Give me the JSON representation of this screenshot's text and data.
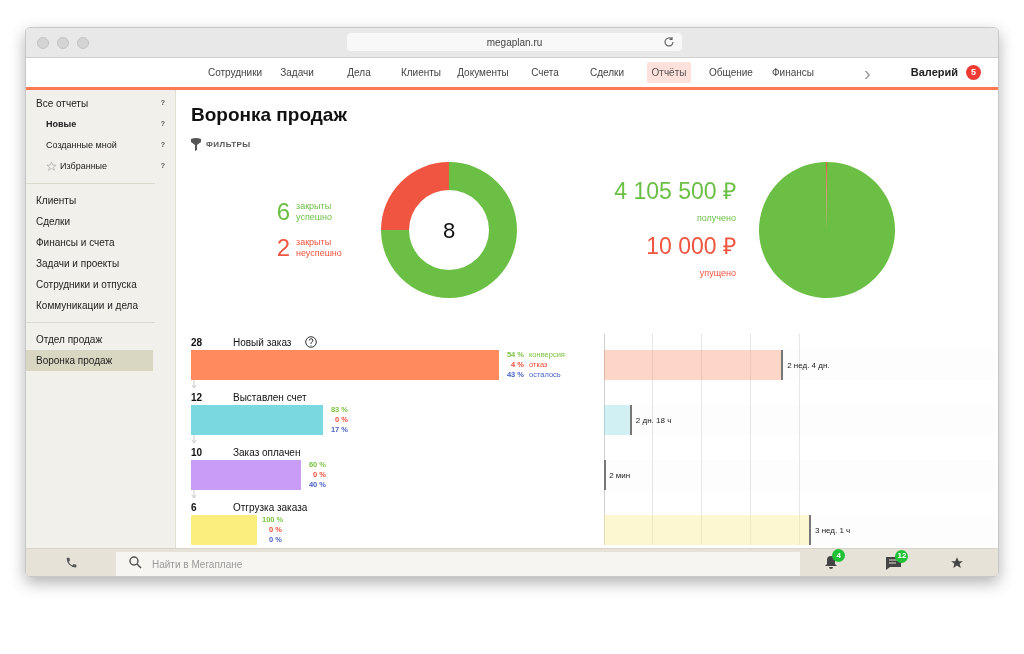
{
  "browser": {
    "url": "megaplan.ru"
  },
  "nav": {
    "items": [
      {
        "label": "Сотрудники",
        "selected": false
      },
      {
        "label": "Задачи",
        "selected": false
      },
      {
        "label": "Дела",
        "selected": false
      },
      {
        "label": "Клиенты",
        "selected": false
      },
      {
        "label": "Документы",
        "selected": false
      },
      {
        "label": "Счета",
        "selected": false
      },
      {
        "label": "Сделки",
        "selected": false
      },
      {
        "label": "Отчёты",
        "selected": true
      },
      {
        "label": "Общение",
        "selected": false
      },
      {
        "label": "Финансы",
        "selected": false
      }
    ],
    "more": "›",
    "user": "Валерий",
    "user_badge": "5"
  },
  "sidebar": {
    "groups": [
      {
        "items": [
          {
            "label": "Все отчеты",
            "help": "?",
            "selected": false,
            "children": [
              {
                "label": "Новые",
                "help": "?",
                "kind": "plain",
                "active": true
              },
              {
                "label": "Созданные мной",
                "help": "?",
                "kind": "plain",
                "active": false
              },
              {
                "label": "Избранные",
                "help": "?",
                "kind": "starred",
                "active": false
              }
            ]
          }
        ]
      },
      {
        "items": [
          {
            "label": "Клиенты",
            "selected": false
          },
          {
            "label": "Сделки",
            "selected": false
          },
          {
            "label": "Финансы и счета",
            "selected": false
          },
          {
            "label": "Задачи и проекты",
            "selected": false
          },
          {
            "label": "Сотрудники и отпуска",
            "selected": false
          },
          {
            "label": "Коммуникации и дела",
            "selected": false
          }
        ]
      },
      {
        "items": [
          {
            "label": "Отдел продаж",
            "selected": false
          },
          {
            "label": "Воронка продаж",
            "selected": true
          }
        ]
      }
    ]
  },
  "page": {
    "title": "Воронка продаж",
    "filters": "ФИЛЬТРЫ"
  },
  "deals": {
    "stats": [
      {
        "value": "6",
        "label": "закрыты успешно",
        "color": "#6cbf45"
      },
      {
        "value": "2",
        "label": "закрыты неуспешно",
        "color": "#ef5540"
      }
    ],
    "total": "8"
  },
  "money": {
    "stats": [
      {
        "value": "4 105 500 ₽",
        "label": "получено",
        "color": "#6cbf45"
      },
      {
        "value": "10 000 ₽",
        "label": "упущено",
        "color": "#ef5540"
      }
    ]
  },
  "funnel": {
    "legend": [
      "конверсия",
      "отказ",
      "осталось"
    ],
    "stages": [
      {
        "count": "28",
        "name": "Новый заказ",
        "help": true,
        "color": "#fe8a5e",
        "conversion": "54 %",
        "refusal": "4 %",
        "remaining": "43 %",
        "duration": {
          "text": "2 нед. 4 дн.",
          "level": 0.457
        }
      },
      {
        "count": "12",
        "name": "Выставлен счет",
        "help": false,
        "color": "#7ad8e0",
        "conversion": "83 %",
        "refusal": "0 %",
        "remaining": "17 %",
        "duration": {
          "text": "2 дн. 18 ч",
          "level": 0.071
        }
      },
      {
        "count": "10",
        "name": "Заказ оплачен",
        "help": false,
        "color": "#c99cf7",
        "conversion": "60 %",
        "refusal": "0 %",
        "remaining": "40 %",
        "duration": {
          "text": "2 мин",
          "level": 0.003
        }
      },
      {
        "count": "6",
        "name": "Отгрузка заказа",
        "help": false,
        "color": "#fbee7c",
        "conversion": "100 %",
        "refusal": "0 %",
        "remaining": "0 %",
        "duration": {
          "text": "3 нед. 1 ч",
          "level": 0.528
        }
      }
    ]
  },
  "bottom_bar": {
    "search_placeholder": "Найти в Мегаплане",
    "notifications": "4",
    "messages": "12"
  }
}
